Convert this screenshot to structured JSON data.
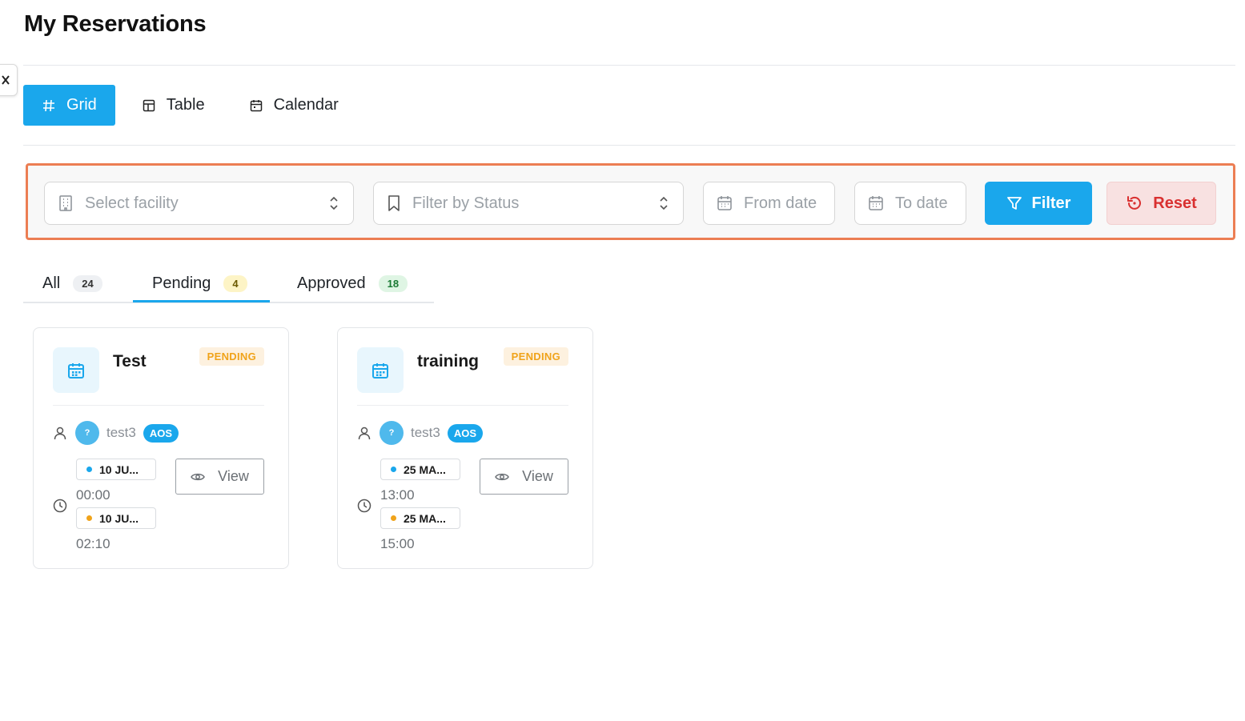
{
  "page": {
    "title": "My Reservations"
  },
  "view_switcher": {
    "options": [
      {
        "label": "Grid",
        "icon": "grid-icon",
        "active": true
      },
      {
        "label": "Table",
        "icon": "table-icon",
        "active": false
      },
      {
        "label": "Calendar",
        "icon": "calendar-icon",
        "active": false
      }
    ]
  },
  "filters": {
    "facility_placeholder": "Select facility",
    "status_placeholder": "Filter by Status",
    "from_date_placeholder": "From date",
    "to_date_placeholder": "To date",
    "filter_label": "Filter",
    "reset_label": "Reset"
  },
  "status_tabs": [
    {
      "label": "All",
      "count": "24",
      "active": false
    },
    {
      "label": "Pending",
      "count": "4",
      "active": true
    },
    {
      "label": "Approved",
      "count": "18",
      "active": false
    }
  ],
  "reservations": [
    {
      "title": "Test",
      "status": "PENDING",
      "avatar": "?",
      "user": "test3",
      "org": "AOS",
      "start_date": "10 JU...",
      "start_time": "00:00",
      "end_date": "10 JU...",
      "end_time": "02:10",
      "view_label": "View"
    },
    {
      "title": "training",
      "status": "PENDING",
      "avatar": "?",
      "user": "test3",
      "org": "AOS",
      "start_date": "25 MA...",
      "start_time": "13:00",
      "end_date": "25 MA...",
      "end_time": "15:00",
      "view_label": "View"
    }
  ],
  "colors": {
    "accent": "#1aa7ec",
    "pending": "#f0a31a",
    "danger": "#d93030",
    "highlight_border": "#ec7e53"
  }
}
